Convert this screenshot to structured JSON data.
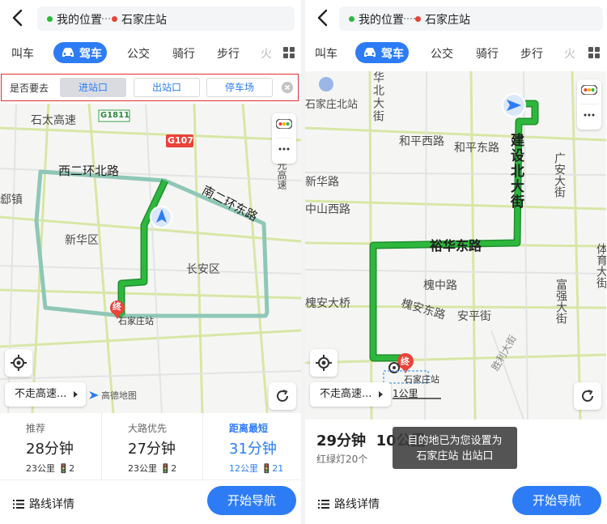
{
  "left": {
    "route": {
      "from": "我的位置",
      "to": "石家庄站"
    },
    "tabs": [
      "叫车",
      "驾车",
      "公交",
      "骑行",
      "步行",
      "火"
    ],
    "filter": {
      "label": "是否要去",
      "options": [
        "进站口",
        "出站口",
        "停车场"
      ]
    },
    "map": {
      "labels": [
        "石太高速",
        "G1811",
        "G107",
        "西二环北路",
        "南二环东路",
        "新华区",
        "长安区",
        "石家庄站",
        "郄镇",
        "元高速",
        "终"
      ],
      "no_highway": "不走高速...",
      "logo": "高德地图"
    },
    "routes": [
      {
        "title": "推荐",
        "time": "28分钟",
        "meta": "23公里",
        "lights": "2"
      },
      {
        "title": "大路优先",
        "time": "27分钟",
        "meta": "23公里",
        "lights": "2"
      },
      {
        "title": "距离最短",
        "time": "31分钟",
        "meta": "12公里",
        "lights": "21"
      }
    ],
    "details": "路线详情",
    "nav": "开始导航"
  },
  "right": {
    "route": {
      "from": "我的位置",
      "to": "石家庄站"
    },
    "tabs": [
      "叫车",
      "驾车",
      "公交",
      "骑行",
      "步行",
      "火"
    ],
    "map": {
      "labels": [
        "石家庄北站",
        "华北大街",
        "和平西路",
        "和平东路",
        "建设北大街",
        "广安大街",
        "新华路",
        "中山西路",
        "裕华东路",
        "槐中路",
        "槐安东路",
        "安平街",
        "槐安大桥",
        "富强大街",
        "体育大街",
        "石家庄站",
        "胜利大街",
        "终"
      ],
      "no_highway": "不走高速...",
      "scale": "1公里"
    },
    "summary": {
      "time": "29分钟",
      "distance": "10公里",
      "lights": "红绿灯20个"
    },
    "toast": [
      "目的地已为您设置为",
      "石家庄站 出站口"
    ],
    "details": "路线详情",
    "nav": "开始导航"
  },
  "colors": {
    "accent": "#2d7cf6",
    "route_green": "#2db83d",
    "alt_route": "#8fc7b6",
    "dest_red": "#e9433a"
  }
}
